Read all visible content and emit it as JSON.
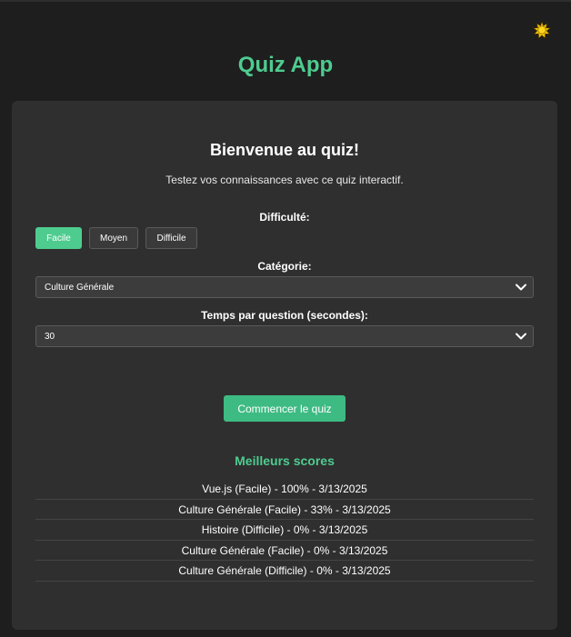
{
  "header": {
    "title": "Quiz App",
    "theme_icon": "sun-icon"
  },
  "welcome": {
    "title": "Bienvenue au quiz!",
    "text": "Testez vos connaissances avec ce quiz interactif."
  },
  "difficulty": {
    "label": "Difficulté:",
    "options": [
      "Facile",
      "Moyen",
      "Difficile"
    ],
    "selected": "Facile"
  },
  "category": {
    "label": "Catégorie:",
    "value": "Culture Générale"
  },
  "time": {
    "label": "Temps par question (secondes):",
    "value": "30"
  },
  "start_label": "Commencer le quiz",
  "scores": {
    "title": "Meilleurs scores",
    "items": [
      "Vue.js (Facile) - 100% - 3/13/2025",
      "Culture Générale (Facile) - 33% - 3/13/2025",
      "Histoire (Difficile) - 0% - 3/13/2025",
      "Culture Générale (Facile) - 0% - 3/13/2025",
      "Culture Générale (Difficile) - 0% - 3/13/2025"
    ]
  },
  "colors": {
    "accent": "#4ecc8f",
    "button": "#3dbb83",
    "background": "#1e1e1e",
    "card": "#2f2f2f",
    "sun": "#f2c200"
  }
}
